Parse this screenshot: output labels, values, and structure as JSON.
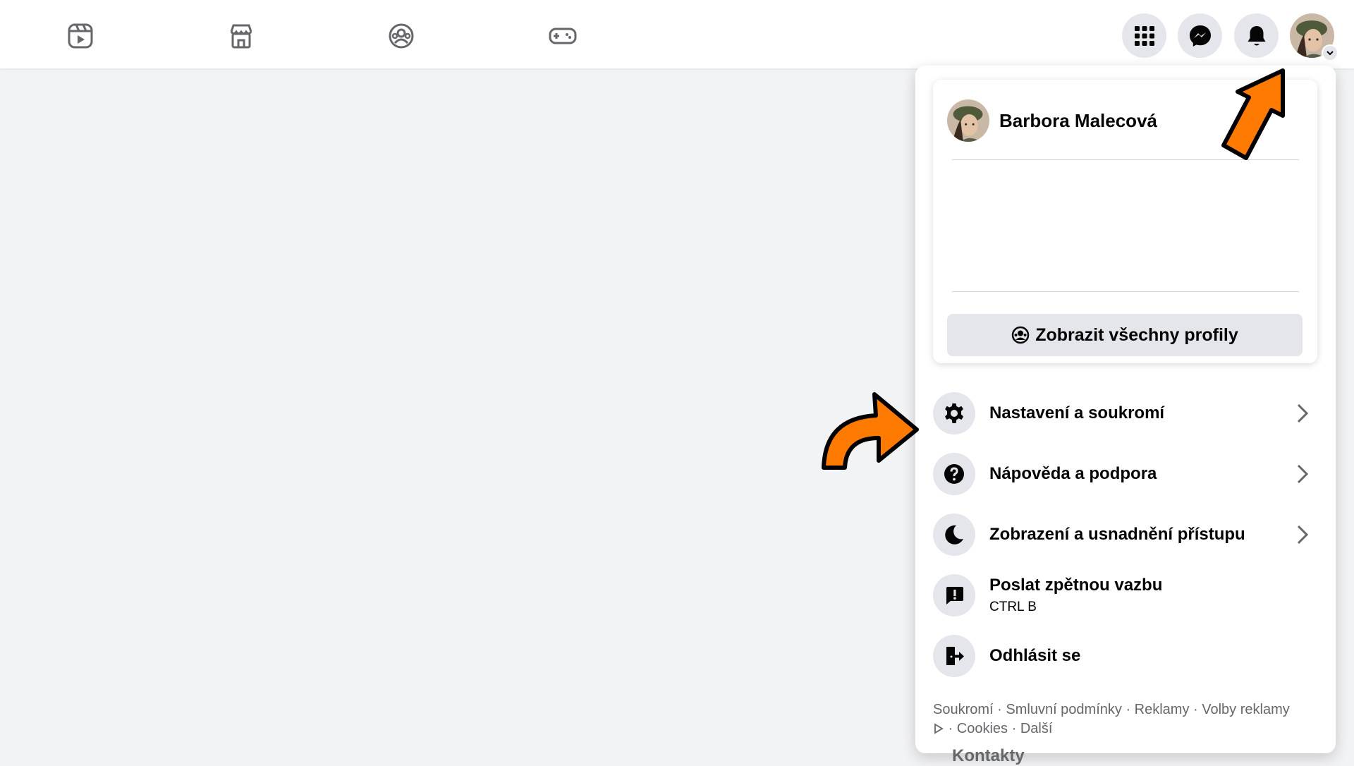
{
  "app": {
    "nav_icons": [
      "reels-icon",
      "marketplace-icon",
      "groups-icon",
      "gaming-icon"
    ],
    "top_buttons": [
      "menu-grid-icon",
      "messenger-icon",
      "notifications-icon"
    ]
  },
  "profile": {
    "name": "Barbora Malecová",
    "see_all_profiles": "Zobrazit všechny profily"
  },
  "menu": {
    "items": [
      {
        "label": "Nastavení a soukromí",
        "icon": "gear-icon"
      },
      {
        "label": "Nápověda a podpora",
        "icon": "help-icon"
      },
      {
        "label": "Zobrazení a usnadnění přístupu",
        "icon": "moon-icon"
      },
      {
        "label": "Poslat zpětnou vazbu",
        "sub": "CTRL B",
        "icon": "feedback-icon"
      },
      {
        "label": "Odhlásit se",
        "icon": "logout-icon"
      }
    ]
  },
  "footer": {
    "links": [
      "Soukromí",
      "Smluvní podmínky",
      "Reklamy",
      "Volby reklamy",
      "Cookies",
      "Další"
    ],
    "sep": " · "
  },
  "sidebar": {
    "contacts_label": "Kontakty"
  },
  "colors": {
    "accent_arrow": "#ff7a00",
    "surface": "#ffffff",
    "background": "#f2f3f5",
    "button_bg": "#e4e6eb"
  }
}
